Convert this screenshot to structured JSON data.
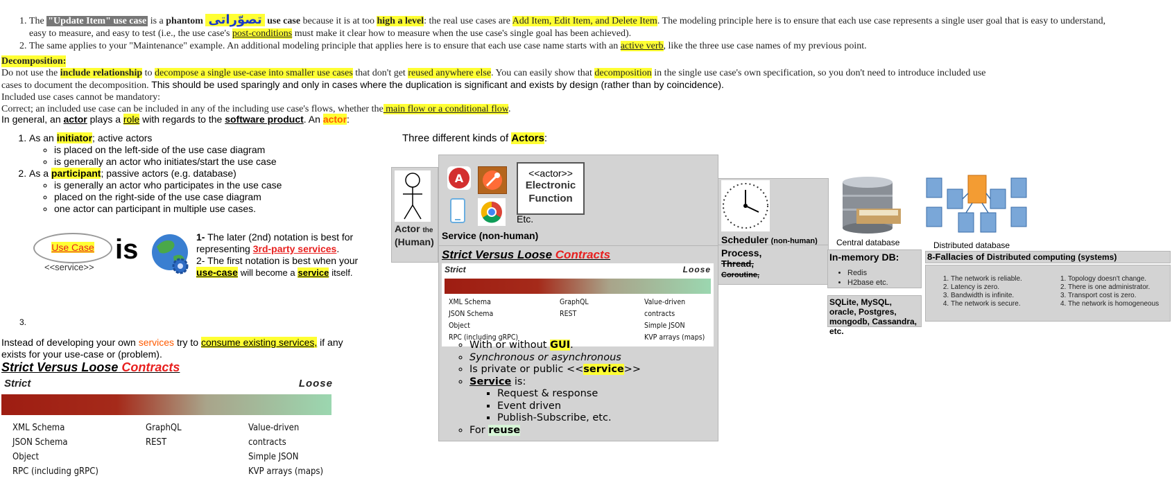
{
  "top_list": {
    "item1": {
      "prefix": "The",
      "grey_term": "\"Update Item\" use case",
      "is_a": "is a",
      "phantom": "phantom",
      "urdu_word": "تصوّراتی",
      "use_case": "use case",
      "because": "because it is at too",
      "high_level": "high a level",
      "real_cases_prefix": ": the real use cases are",
      "real_cases": "Add Item, Edit Item, and Delete Item",
      "rest1": ". The modeling principle here is to ensure that each use case represents a single user goal that is easy to understand, easy to measure, and easy to test (i.e., the use case's",
      "post_conditions": "post-conditions",
      "rest2": "must make it clear how to measure when the use case's single goal has been achieved)."
    },
    "item2": {
      "text1": "The same applies to your \"Maintenance\" example. An additional modeling principle that applies here is to ensure that each use case name starts with an",
      "active_verb": "active verb",
      "text2": ", like the three use case names of my previous point."
    }
  },
  "decomposition": {
    "heading": "Decomposition:",
    "p1_a": "Do not use the",
    "include_rel": "include relationship",
    "p1_b": "to",
    "decompose": "decompose a single use-case into smaller use cases",
    "p1_c": "that don't get",
    "reused": "reused anywhere else",
    "p1_d": ". You can easily show that",
    "decomp": "decomposition",
    "p1_e": "in the single use case's own specification, so you don't need to introduce included use cases to document the decomposition.",
    "p1_f": "This should be used sparingly and only in cases where the duplication is significant and exists by design (rather than by coincidence).",
    "p2": "Included use cases cannot be mandatory:",
    "p3_a": "Correct; an included use case can be included in any of the including use case's flows, whether the",
    "main_flow": " main flow or a conditional flow",
    "p3_b": "."
  },
  "actors": {
    "intro_a": "In general, an",
    "actor": "actor",
    "intro_b": "plays a",
    "role": "role",
    "intro_c": "with regards to the",
    "software_product": "software product",
    "intro_d": ". An",
    "actor2": "actor",
    "intro_e": ":",
    "item1_a": "As an",
    "initiator": "initiator",
    "item1_b": "; active actors",
    "item1_sub": [
      "is placed on the left-side of the use case diagram",
      "is generally an actor who initiates/start the use case"
    ],
    "item2_a": "As a",
    "participant": "participant",
    "item2_b": "; passive actors (e.g. database)",
    "item2_sub": [
      "is generally an actor who participates in the use case",
      "placed on the right-side of the use case diagram",
      "one actor can participant in multiple use cases."
    ],
    "item3_num": "3.",
    "usecase_oval": "Use Case",
    "service_stereo": "<<service>>",
    "is_word": "is",
    "note1_num": "1-",
    "note1_a": "The later (2nd) notation is best for representing",
    "note1_b": "3rd-party services",
    "note1_c": ".",
    "note2_num": "2-",
    "note2_a": "The first notation is best when your",
    "note2_b": "use-case",
    "note2_c": "will become a",
    "note2_d": "service",
    "note2_e": "itself."
  },
  "services_note": {
    "a": "Instead of developing your own",
    "services": "services",
    "b": "try to",
    "consume": "consume existing services,",
    "c": "if any exists for your use-case or (problem)."
  },
  "contract": {
    "title_a": "Strict Versus Loose",
    "title_b": "Contracts",
    "strict": "Strict",
    "loose": "Loose",
    "col1": [
      "XML Schema",
      "JSON Schema",
      "Object",
      "RPC (including gRPC)"
    ],
    "col2": [
      "GraphQL",
      "REST"
    ],
    "col3": [
      "Value-driven contracts",
      "Simple JSON",
      "KVP arrays (maps)"
    ]
  },
  "kinds": {
    "heading_a": "Three different kinds of",
    "heading_b": "Actors",
    "heading_c": ":",
    "actor_label": "Actor",
    "actor_the": "the",
    "actor_human": "(Human)",
    "actor_stereo": "<<actor>>",
    "electronic": "Electronic Function",
    "etc": "Etc.",
    "service_label": "Service (non-human)",
    "scheduler_label": "Scheduler",
    "scheduler_sub": "(non-human)",
    "central_db": "Central database",
    "distributed_db": "Distributed database"
  },
  "service_list": {
    "items": [
      "With or without",
      "Synchronous or asynchronous",
      "Is private or public <<",
      "Service"
    ],
    "gui": "GUI",
    "gui_dot": ".",
    "service_word": "service",
    "close": ">>",
    "is": "is:",
    "sub": [
      "Request & response",
      "Event driven",
      "Publish-Subscribe, etc."
    ],
    "for": "For",
    "reuse": "reuse"
  },
  "process": {
    "process": "Process,",
    "thread": "Thread,",
    "coroutine": "Coroutine,"
  },
  "inmemory": {
    "title": "In-memory DB:",
    "items": [
      "Redis",
      "H2base etc."
    ],
    "sql": "SQLite, MySQL, oracle, Postgres, mongodb, Cassandra, etc."
  },
  "fallacies": {
    "title_a": "8-Fallacies of",
    "title_b": "Distributed computing (systems)",
    "left": [
      "The network is reliable.",
      "Latency is zero.",
      "Bandwidth is infinite.",
      "The network is secure."
    ],
    "right": [
      "Topology doesn't change.",
      "There is one administrator.",
      "Transport cost is zero.",
      "The network is homogeneous"
    ]
  }
}
